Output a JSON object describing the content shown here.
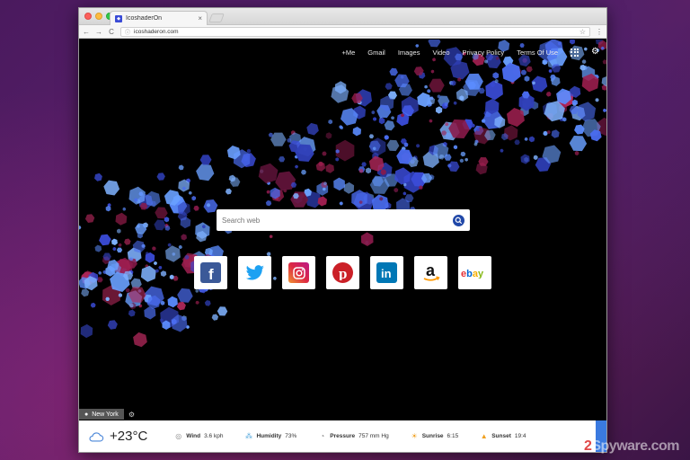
{
  "browser": {
    "tab_title": "IcoshaderOn",
    "tab_favicon": "icosahedron-icon",
    "tab_close": "×",
    "url": "icoshaderon.com",
    "url_info": "ⓘ",
    "star": "☆",
    "menu": "⋮",
    "back": "←",
    "forward": "→",
    "reload": "C"
  },
  "topnav": {
    "links": [
      "+Me",
      "Gmail",
      "Images",
      "Video",
      "Privacy Policy",
      "Terms Of Use"
    ],
    "apps_icon": "apps-grid-icon",
    "settings_icon": "gear-icon"
  },
  "search": {
    "placeholder": "Search web"
  },
  "tiles": [
    {
      "name": "facebook",
      "icon": "facebook-icon",
      "color": "#3b5998"
    },
    {
      "name": "twitter",
      "icon": "twitter-icon",
      "color": "#1da1f2"
    },
    {
      "name": "instagram",
      "icon": "instagram-icon",
      "color": "#c13584"
    },
    {
      "name": "pinterest",
      "icon": "pinterest-icon",
      "color": "#cb2027"
    },
    {
      "name": "linkedin",
      "icon": "linkedin-icon",
      "color": "#0077b5"
    },
    {
      "name": "amazon",
      "icon": "amazon-icon",
      "color": "#000000"
    },
    {
      "name": "ebay",
      "icon": "ebay-icon",
      "color": "#e53238"
    }
  ],
  "location": {
    "city": "New York"
  },
  "weather": {
    "temp": "+23°C",
    "wind_label": "Wind",
    "wind_value": "3.6 kph",
    "humidity_label": "Humidity",
    "humidity_value": "73%",
    "pressure_label": "Pressure",
    "pressure_value": "757 mm Hg",
    "sunrise_label": "Sunrise",
    "sunrise_value": "6:15",
    "sunset_label": "Sunset",
    "sunset_value": "19:4"
  },
  "watermark": {
    "digit": "2",
    "text": "Spyware.com"
  },
  "colors": {
    "accent": "#3a7ae0",
    "search_button": "#2148a8"
  }
}
